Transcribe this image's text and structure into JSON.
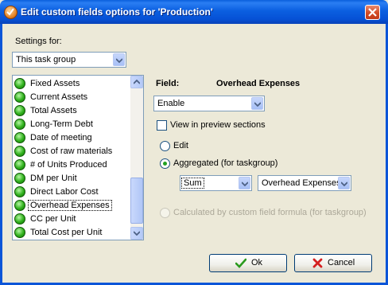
{
  "window": {
    "title": "Edit custom fields options for  'Production'"
  },
  "settings_for": {
    "label": "Settings for:",
    "value": "This task group"
  },
  "fields_list": {
    "items": [
      "Fixed Assets",
      "Current Assets",
      "Total Assets",
      "Long-Term Debt",
      "Date of meeting",
      "Cost of raw materials",
      "# of Units Produced",
      "DM per Unit",
      "Direct Labor Cost",
      "Overhead Expenses",
      "CC per Unit",
      "Total Cost per Unit"
    ],
    "selected": "Overhead Expenses"
  },
  "field": {
    "label": "Field:",
    "name": "Overhead Expenses"
  },
  "mode": {
    "value": "Enable"
  },
  "view_in_preview": {
    "label": "View in preview sections",
    "checked": false
  },
  "options": {
    "edit": "Edit",
    "aggregated": "Aggregated (for taskgroup)",
    "calculated": "Calculated by custom field formula (for taskgroup)",
    "selected": "aggregated"
  },
  "aggregate_function": {
    "value": "Sum"
  },
  "aggregate_field": {
    "value": "Overhead Expenses"
  },
  "buttons": {
    "ok": "Ok",
    "cancel": "Cancel"
  },
  "colors": {
    "titlebar": "#0b5fe0",
    "dialog_bg": "#ece9d8",
    "status_dot": "#2fb01c",
    "cancel_icon": "#d42020",
    "ok_icon": "#2a9a1e"
  }
}
